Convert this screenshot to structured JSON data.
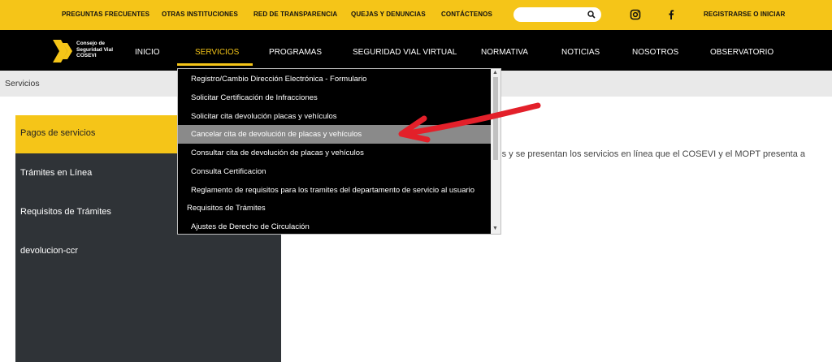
{
  "top_links": [
    "PREGUNTAS FRECUENTES",
    "OTRAS INSTITUCIONES",
    "RED DE TRANSPARENCIA",
    "QUEJAS Y DENUNCIAS",
    "CONTÁCTENOS"
  ],
  "search": {
    "placeholder": ""
  },
  "social": [
    "instagram-icon",
    "facebook-icon"
  ],
  "auth_link": "REGISTRARSE O INICIAR",
  "logo": {
    "line1": "Consejo de",
    "line2": "Seguridad Vial",
    "line3": "COSEVI"
  },
  "nav": [
    "INICIO",
    "SERVICIOS",
    "PROGRAMAS",
    "SEGURIDAD VIAL VIRTUAL",
    "NORMATIVA",
    "NOTICIAS",
    "NOSOTROS",
    "OBSERVATORIO"
  ],
  "nav_active": "SERVICIOS",
  "breadcrumb": "Servicios",
  "sidebar": [
    "Pagos de servicios",
    "Trámites en Línea",
    "Requisitos de Trámites",
    "devolucion-ccr"
  ],
  "main_text": "ites y se presentan los servicios en línea que el COSEVI y el MOPT  presenta  a",
  "dropdown": [
    "Registro/Cambio Dirección Electrónica - Formulario",
    "Solicitar Certificación de Infracciones",
    "Solicitar cita devolución placas y vehículos",
    "Cancelar cita de devolución de placas y vehículos",
    "Consultar cita de devolución de placas y vehículos",
    "Consulta Certificacion",
    "Reglamento de requisitos para los tramites del departamento de servicio al usuario",
    "Requisitos de Trámites",
    "Ajustes de Derecho de Circulación"
  ],
  "dropdown_highlighted_index": 3,
  "colors": {
    "brand_yellow": "#f5c518",
    "nav_black": "#000000",
    "sidebar_dark": "#2f3337",
    "annotation_red": "#e3202a"
  }
}
